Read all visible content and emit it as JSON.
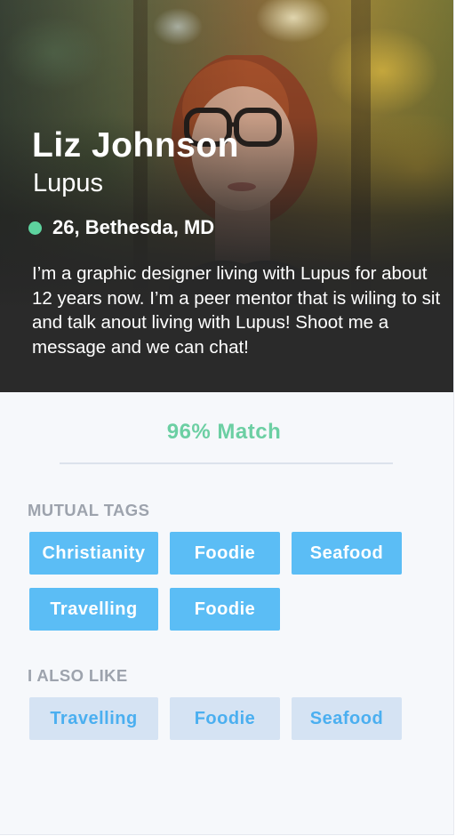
{
  "profile": {
    "name": "Liz Johnson",
    "condition": "Lupus",
    "location": "26, Bethesda, MD",
    "status_color": "#5dd39e",
    "bio": "I’m a graphic designer living with Lupus for about 12 years now. I’m a peer mentor that is wiling to sit and talk anout living with Lupus! Shoot me a message and we can chat!"
  },
  "match": {
    "label": "96% Match",
    "percent": 96,
    "color": "#6ccfa3"
  },
  "mutual_tags": {
    "title": "MUTUAL TAGS",
    "items": [
      "Christianity",
      "Foodie",
      "Seafood",
      "Travelling",
      "Foodie"
    ]
  },
  "also_like": {
    "title": "I ALSO LIKE",
    "items": [
      "Travelling",
      "Foodie",
      "Seafood"
    ]
  },
  "colors": {
    "tag_mutual_bg": "#5bbdf5",
    "tag_like_bg": "#d5e3f3",
    "tag_like_text": "#4baff0"
  }
}
